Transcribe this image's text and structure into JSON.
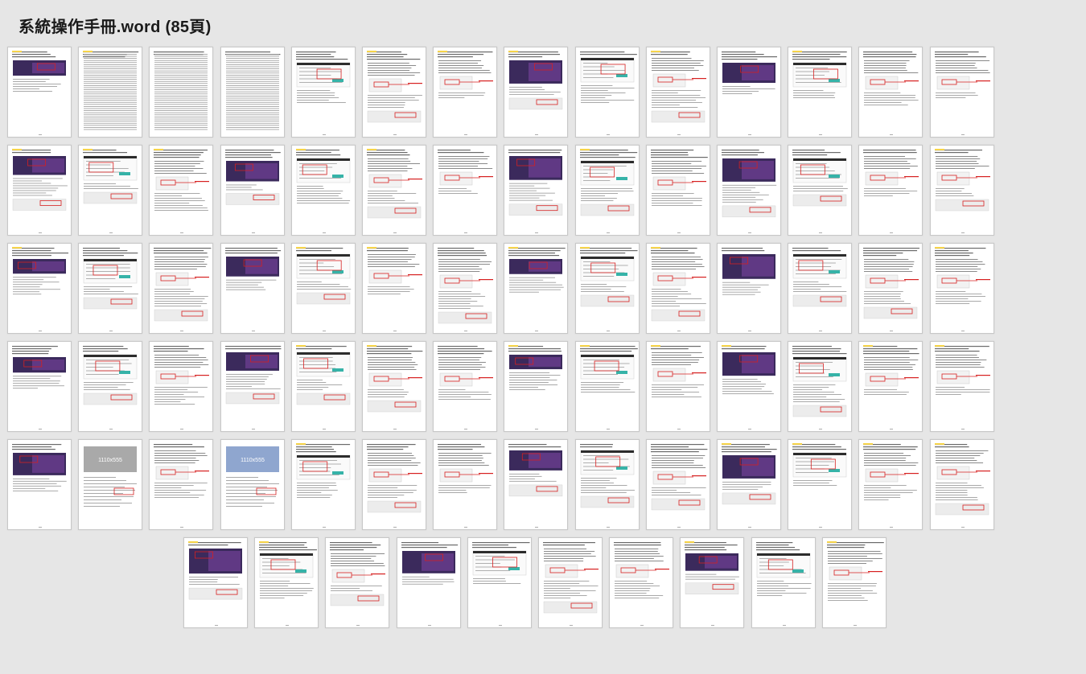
{
  "document": {
    "title": "系統操作手冊.word (85頁)",
    "page_count": 85
  },
  "thumbnails": {
    "rows": [
      14,
      14,
      14,
      14,
      14,
      10
    ],
    "placeholder_labels": {
      "57": "1110x555",
      "59": "1110x555"
    }
  },
  "colors": {
    "background": "#e6e6e6",
    "page": "#ffffff",
    "annotation": "#d62020",
    "banner_dark": "#3b2a5c",
    "banner_purple": "#6a3d8f",
    "header_bar": "#2c2c2c",
    "placeholder_blue": "#8fa6cf",
    "placeholder_gray": "#a9a9a9",
    "highlight_yellow": "#f6d44a",
    "link_blue": "#2a6fdb"
  }
}
